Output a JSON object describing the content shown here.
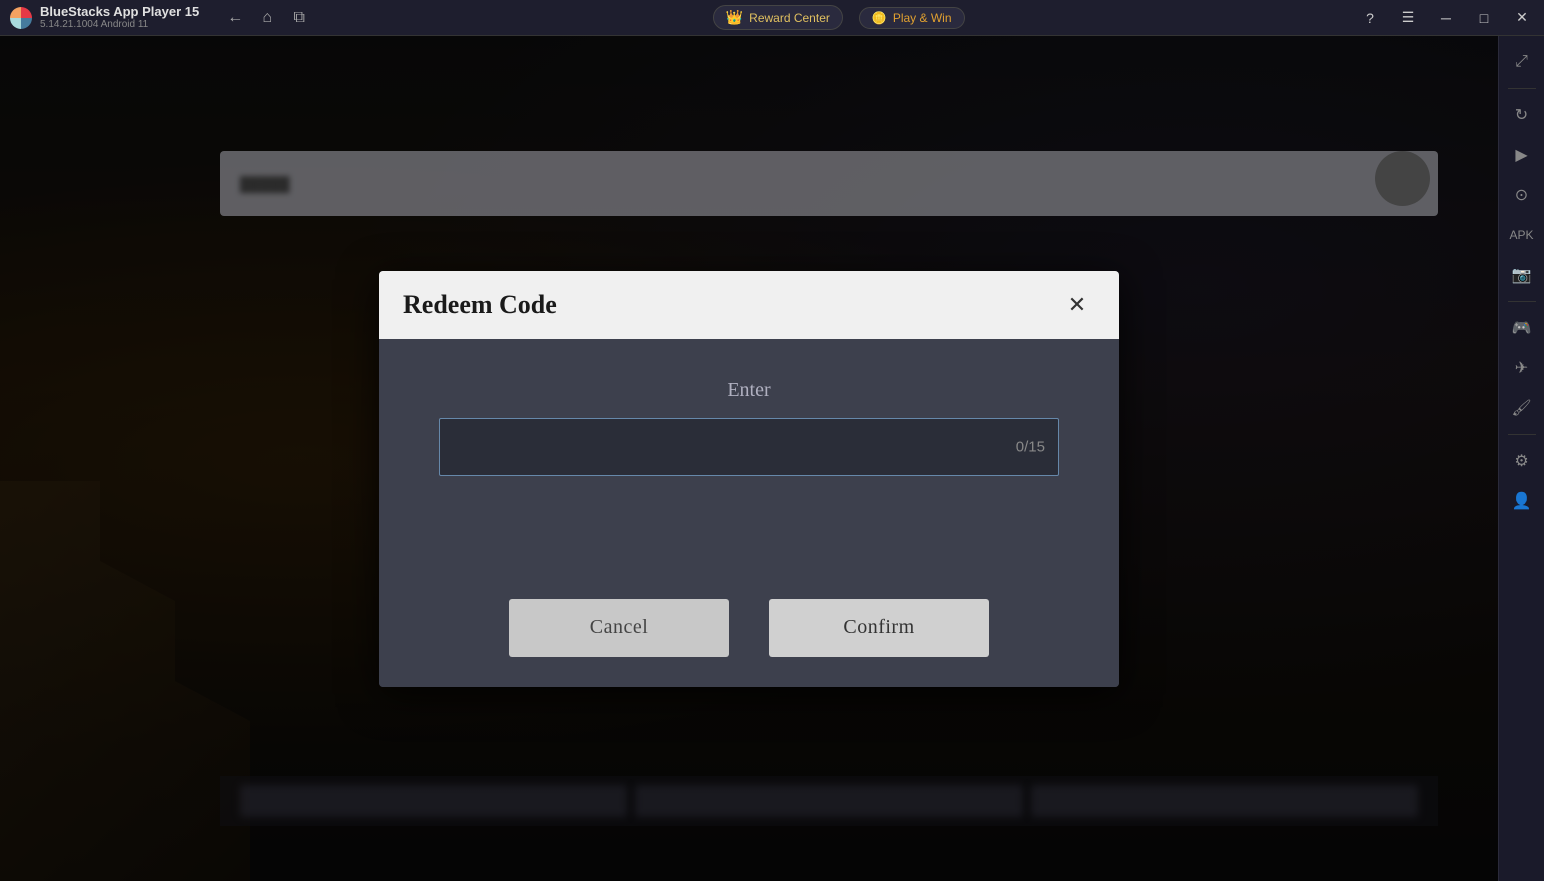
{
  "app": {
    "title": "BlueStacks App Player 15",
    "version": "5.14.21.1004  Android 11",
    "logo_label": "BlueStacks logo"
  },
  "titlebar": {
    "back_label": "←",
    "home_label": "⌂",
    "pages_label": "⧉",
    "reward_center_label": "Reward Center",
    "play_win_label": "Play & Win",
    "help_label": "?",
    "menu_label": "☰",
    "minimize_label": "─",
    "maximize_label": "□",
    "close_label": "✕",
    "expand_label": "⤢"
  },
  "sidebar": {
    "icons": [
      {
        "name": "expand-icon",
        "symbol": "⤢"
      },
      {
        "name": "rotate-icon",
        "symbol": "↻"
      },
      {
        "name": "video-icon",
        "symbol": "▶"
      },
      {
        "name": "search-icon",
        "symbol": "⊙"
      },
      {
        "name": "apk-icon",
        "symbol": "📦"
      },
      {
        "name": "screenshot-icon",
        "symbol": "📷"
      },
      {
        "name": "gamepad-icon",
        "symbol": "🎮"
      },
      {
        "name": "airplane-icon",
        "symbol": "✈"
      },
      {
        "name": "brush-icon",
        "symbol": "🖌"
      },
      {
        "name": "settings-icon",
        "symbol": "⚙"
      },
      {
        "name": "person-icon",
        "symbol": "👤"
      }
    ]
  },
  "dialog": {
    "title": "Redeem Code",
    "close_label": "✕",
    "enter_label": "Enter",
    "input_placeholder": "",
    "input_counter": "0/15",
    "cancel_label": "Cancel",
    "confirm_label": "Confirm"
  }
}
